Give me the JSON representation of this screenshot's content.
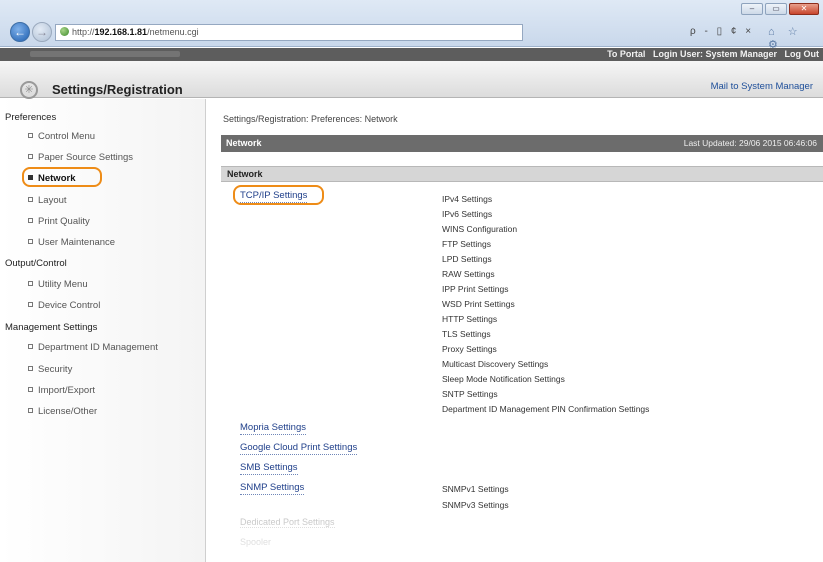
{
  "browser": {
    "url_prefix": "http://",
    "url_host": "192.168.1.81",
    "url_path": "/netmenu.cgi",
    "address_tools": "ρ - ▯ ¢ ×",
    "fav_tools": "⌂ ☆ ⚙",
    "window_buttons": [
      "–",
      "▭",
      "✕"
    ]
  },
  "topbar": {
    "portal": "To Portal",
    "login": "Login User: System Manager",
    "logout": "Log Out"
  },
  "header": {
    "title": "Settings/Registration",
    "mail_link": "Mail to System Manager"
  },
  "sidebar": {
    "preferences_label": "Preferences",
    "preferences_items": [
      "Control Menu",
      "Paper Source Settings",
      "Network",
      "Layout",
      "Print Quality",
      "User Maintenance"
    ],
    "output_label": "Output/Control",
    "output_items": [
      "Utility Menu",
      "Device Control"
    ],
    "management_label": "Management Settings",
    "management_items": [
      "Department ID Management",
      "Security",
      "Import/Export",
      "License/Other"
    ]
  },
  "main": {
    "breadcrumb": "Settings/Registration: Preferences: Network",
    "header_bar": "Network",
    "last_updated": "Last Updated: 29/06 2015 06:46:06",
    "section_label": "Network",
    "tcpip_link": "TCP/IP Settings",
    "tcpip_subitems": [
      "IPv4 Settings",
      "IPv6 Settings",
      "WINS Configuration",
      "FTP Settings",
      "LPD Settings",
      "RAW Settings",
      "IPP Print Settings",
      "WSD Print Settings",
      "HTTP Settings",
      "TLS Settings",
      "Proxy Settings",
      "Multicast Discovery Settings",
      "Sleep Mode Notification Settings",
      "SNTP Settings",
      "Department ID Management PIN Confirmation Settings"
    ],
    "mopria_link": "Mopria Settings",
    "gcp_link": "Google Cloud Print Settings",
    "smb_link": "SMB Settings",
    "snmp_link": "SNMP Settings",
    "snmp_subitems": [
      "SNMPv1 Settings",
      "SNMPv3 Settings"
    ],
    "dedicated_port": "Dedicated Port Settings",
    "spooler": "Spooler"
  }
}
